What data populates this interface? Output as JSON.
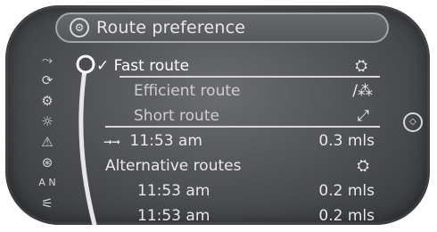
{
  "header": {
    "title": "Route preference",
    "icon": "navigation-gear-icon"
  },
  "left_icons": [
    {
      "name": "route-icon",
      "glyph": "⤳"
    },
    {
      "name": "map-icon",
      "glyph": "⟳"
    },
    {
      "name": "gear-icon",
      "glyph": "⚙"
    },
    {
      "name": "settings-sun-icon",
      "glyph": "☼"
    },
    {
      "name": "warning-icon",
      "glyph": "⚠"
    },
    {
      "name": "compass-icon",
      "glyph": "⊛"
    },
    {
      "name": "north-indicator-icon",
      "glyph": "A N"
    },
    {
      "name": "options-icon",
      "glyph": "⚟"
    }
  ],
  "routes": {
    "fast": {
      "label": "Fast route",
      "check": "✓",
      "icon": "car-icon",
      "glyph": "⛭"
    },
    "efficient": {
      "label": "Efficient route",
      "icon": "eco-route-icon",
      "glyph": "/⁂"
    },
    "short": {
      "label": "Short route",
      "icon": "shortcut-icon",
      "glyph": "⤢"
    }
  },
  "main_route": {
    "time": "11:53 am",
    "distance": "0.3 mls",
    "arrow_glyph": "➞➞"
  },
  "alternatives": {
    "heading": "Alternative routes",
    "icon_glyph": "⛭",
    "items": [
      {
        "time": "11:53 am",
        "distance": "0.2 mls"
      },
      {
        "time": "11:53 am",
        "distance": "0.2 mls"
      }
    ]
  },
  "right_knob_glyph": "◇"
}
